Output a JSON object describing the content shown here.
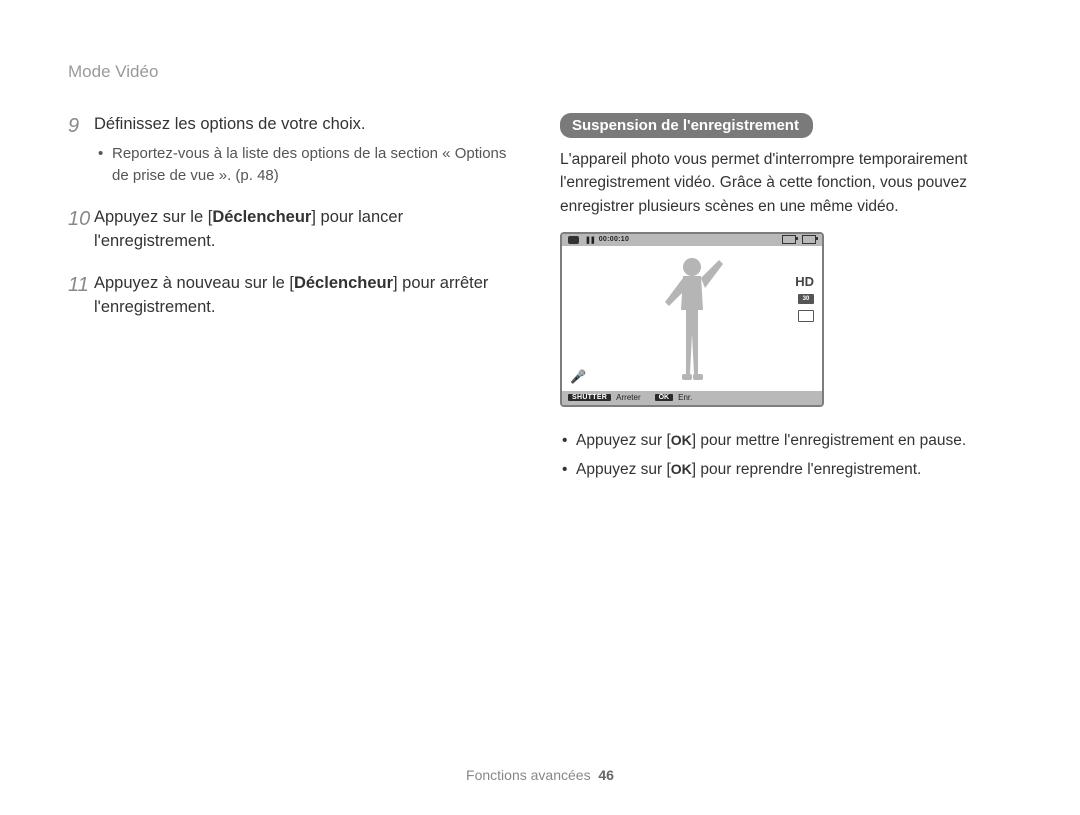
{
  "breadcrumb": "Mode Vidéo",
  "left": {
    "step9": {
      "num": "9",
      "text": "Définissez les options de votre choix.",
      "sub": "Reportez-vous à la liste des options de la section « Options de prise de vue ». (p. 48)"
    },
    "step10": {
      "num": "10",
      "text_before": "Appuyez sur le [",
      "bold": "Déclencheur",
      "text_after": "] pour lancer l'enregistrement."
    },
    "step11": {
      "num": "11",
      "text_before": "Appuyez à nouveau sur le [",
      "bold": "Déclencheur",
      "text_after": "] pour arrêter l'enregistrement."
    }
  },
  "right": {
    "pill": "Suspension de l'enregistrement",
    "para": "L'appareil photo vous permet d'interrompre temporairement l'enregistrement vidéo. Grâce à cette fonction, vous pouvez enregistrer plusieurs scènes en une même vidéo.",
    "lcd": {
      "timecode": "00:00:10",
      "hd": "HD",
      "fps": "30",
      "shutter_label": "SHUTTER",
      "shutter_text": "Arreter",
      "ok_label": "OK",
      "ok_text": "Enr."
    },
    "bullets": {
      "b1_before": "Appuyez sur [",
      "b1_ok": "OK",
      "b1_after": "] pour mettre l'enregistrement en pause.",
      "b2_before": "Appuyez sur [",
      "b2_ok": "OK",
      "b2_after": "] pour reprendre l'enregistrement."
    }
  },
  "footer": {
    "section": "Fonctions avancées",
    "page": "46"
  }
}
